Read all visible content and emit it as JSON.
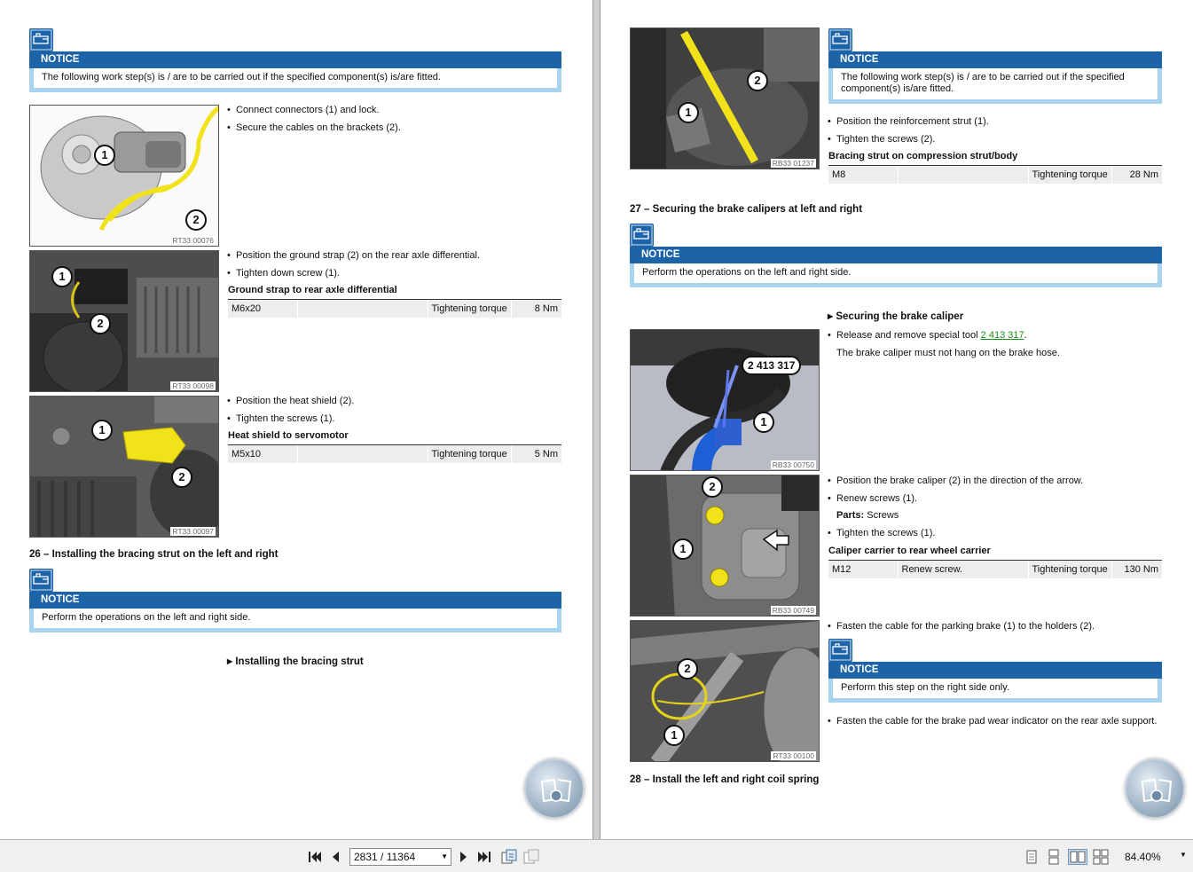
{
  "left": {
    "notice1": {
      "title": "NOTICE",
      "text": "The following work step(s) is / are to be carried out if the specified component(s) is/are fitted."
    },
    "photo1": {
      "code": "RT33 00076",
      "callouts": [
        "1",
        "2"
      ]
    },
    "photo1_bullets": [
      "Connect connectors (1) and lock.",
      "Secure the cables on the brackets (2)."
    ],
    "photo2": {
      "code": "RT33 00098",
      "callouts": [
        "1",
        "2"
      ]
    },
    "photo2_bullets": [
      "Position the ground strap (2) on the rear axle differential.",
      "Tighten down screw (1)."
    ],
    "table1": {
      "heading": "Ground strap to rear axle differential",
      "size": "M6x20",
      "label": "Tightening torque",
      "value": "8 Nm"
    },
    "photo3": {
      "code": "RT33 00097",
      "callouts": [
        "1",
        "2"
      ]
    },
    "photo3_bullets": [
      "Position the heat shield (2).",
      "Tighten the screws (1)."
    ],
    "table2": {
      "heading": "Heat shield to servomotor",
      "size": "M5x10",
      "label": "Tightening torque",
      "value": "5 Nm"
    },
    "section26": "26 – Installing the bracing strut on the left and right",
    "notice2": {
      "title": "NOTICE",
      "text": "Perform the operations on the left and right side."
    },
    "subheading": "Installing the bracing strut"
  },
  "right": {
    "photo1": {
      "code": "RB33 01237",
      "callouts": [
        "1",
        "2"
      ]
    },
    "notice1": {
      "title": "NOTICE",
      "text": "The following work step(s) is / are to be carried out if the specified component(s) is/are fitted."
    },
    "photo1_bullets": [
      "Position the reinforcement strut (1).",
      "Tighten the screws (2)."
    ],
    "table1": {
      "heading": "Bracing strut on compression strut/body",
      "size": "M8",
      "label": "Tightening torque",
      "value": "28 Nm"
    },
    "section27": "27 – Securing the brake calipers at left and right",
    "notice2": {
      "title": "NOTICE",
      "text": "Perform the operations on the left and right side."
    },
    "subheading": "Securing the brake caliper",
    "photo2": {
      "code": "RB33 00750",
      "callouts": [
        "2 413 317",
        "1"
      ]
    },
    "release_text": "Release and remove special tool ",
    "release_link": "2 413 317",
    "release_end": ".",
    "hang_text": "The brake caliper must not hang on the brake hose.",
    "photo3": {
      "code": "RB33 00749",
      "callouts": [
        "2",
        "1"
      ]
    },
    "photo3_bullets": [
      "Position the brake caliper (2) in the direction of the arrow.",
      "Renew screws (1)."
    ],
    "parts_label": "Parts:",
    "parts_value": "Screws",
    "tighten_screws": "Tighten the screws (1).",
    "table2": {
      "heading": "Caliper carrier to rear wheel carrier",
      "size": "M12",
      "note": "Renew screw.",
      "label": "Tightening torque",
      "value": "130 Nm"
    },
    "photo4": {
      "code": "RT33 00100",
      "callouts": [
        "2",
        "1"
      ]
    },
    "fasten_parking": "Fasten the cable for the parking brake (1) to the holders (2).",
    "notice3": {
      "title": "NOTICE",
      "text": "Perform this step on the right side only."
    },
    "fasten_wear": "Fasten the cable for the brake pad wear indicator on the rear axle support.",
    "section28": "28 – Install the left and right coil spring"
  },
  "toolbar": {
    "page_display": "2831 / 11364",
    "zoom": "84.40%",
    "icons": [
      "first-page-icon",
      "prev-page-icon",
      "next-page-icon",
      "last-page-icon",
      "page-thumbnail-icon",
      "page-compare-icon",
      "single-page-view-icon",
      "continuous-view-icon",
      "facing-pages-view-icon",
      "continuous-facing-view-icon"
    ]
  },
  "colors": {
    "notice_blue": "#1d63a8",
    "notice_border": "#a8d4f0",
    "link_green": "#1a8c1a"
  }
}
